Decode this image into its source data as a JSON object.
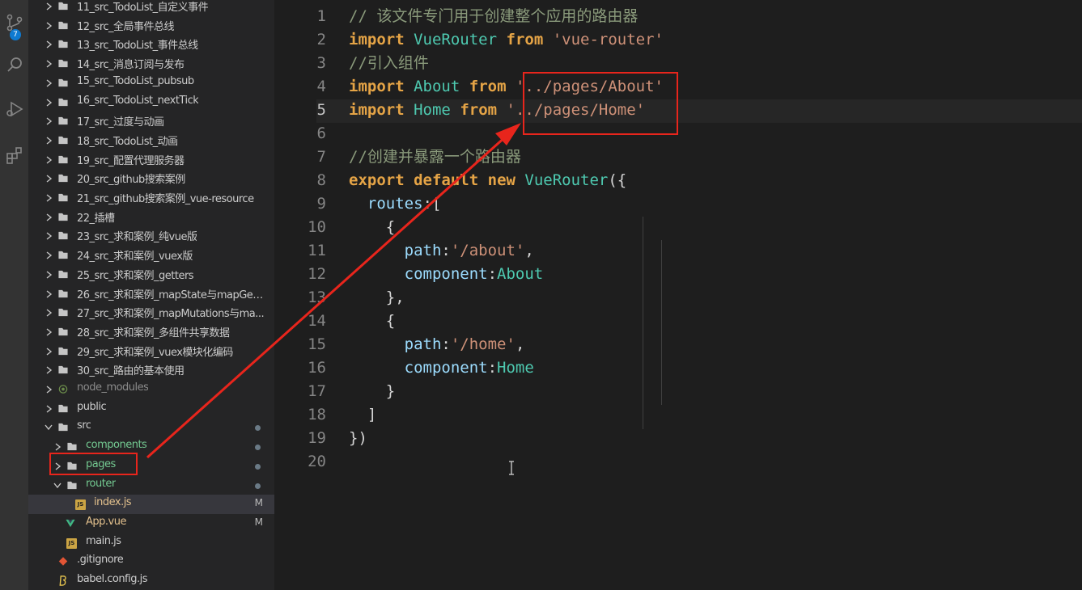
{
  "activity_bar": {
    "items": [
      {
        "icon": "source-control-icon",
        "badge": "7"
      },
      {
        "icon": "search-icon"
      },
      {
        "icon": "run-debug-icon"
      },
      {
        "icon": "extensions-icon"
      }
    ]
  },
  "explorer": {
    "rows": [
      {
        "label": "11_src_TodoList_自定义事件",
        "type": "folder"
      },
      {
        "label": "12_src_全局事件总线",
        "type": "folder"
      },
      {
        "label": "13_src_TodoList_事件总线",
        "type": "folder"
      },
      {
        "label": "14_src_消息订阅与发布",
        "type": "folder"
      },
      {
        "label": "15_src_TodoList_pubsub",
        "type": "folder"
      },
      {
        "label": "16_src_TodoList_nextTick",
        "type": "folder"
      },
      {
        "label": "17_src_过度与动画",
        "type": "folder"
      },
      {
        "label": "18_src_TodoList_动画",
        "type": "folder"
      },
      {
        "label": "19_src_配置代理服务器",
        "type": "folder"
      },
      {
        "label": "20_src_github搜索案例",
        "type": "folder"
      },
      {
        "label": "21_src_github搜索案例_vue-resource",
        "type": "folder"
      },
      {
        "label": "22_插槽",
        "type": "folder"
      },
      {
        "label": "23_src_求和案例_纯vue版",
        "type": "folder"
      },
      {
        "label": "24_src_求和案例_vuex版",
        "type": "folder"
      },
      {
        "label": "25_src_求和案例_getters",
        "type": "folder"
      },
      {
        "label": "26_src_求和案例_mapState与mapGett...",
        "type": "folder"
      },
      {
        "label": "27_src_求和案例_mapMutations与ma...",
        "type": "folder"
      },
      {
        "label": "28_src_求和案例_多组件共享数据",
        "type": "folder"
      },
      {
        "label": "29_src_求和案例_vuex模块化编码",
        "type": "folder"
      },
      {
        "label": "30_src_路由的基本使用",
        "type": "folder"
      },
      {
        "label": "node_modules",
        "type": "folder-dim"
      },
      {
        "label": "public",
        "type": "folder"
      },
      {
        "label": "src",
        "type": "folder-open"
      },
      {
        "label": "components",
        "type": "folder-sub"
      },
      {
        "label": "pages",
        "type": "folder-sub"
      },
      {
        "label": "router",
        "type": "folder-sub-open"
      },
      {
        "label": "index.js",
        "type": "js-file",
        "status": "M"
      },
      {
        "label": "App.vue",
        "type": "vue-file",
        "status": "M"
      },
      {
        "label": "main.js",
        "type": "js-file"
      },
      {
        "label": ".gitignore",
        "type": "git-file"
      },
      {
        "label": "babel.config.js",
        "type": "babel-file"
      }
    ]
  },
  "editor": {
    "lines": [
      {
        "n": "1",
        "tokens": [
          {
            "t": "// 该文件专门用于创建整个应用的路由器",
            "c": "cm"
          }
        ]
      },
      {
        "n": "2",
        "tokens": [
          {
            "t": "import",
            "c": "kw-orange"
          },
          {
            "t": " ",
            "c": "plain"
          },
          {
            "t": "VueRouter",
            "c": "cls"
          },
          {
            "t": " ",
            "c": "plain"
          },
          {
            "t": "from",
            "c": "kw-orange"
          },
          {
            "t": " ",
            "c": "plain"
          },
          {
            "t": "'vue-router'",
            "c": "str"
          }
        ]
      },
      {
        "n": "3",
        "tokens": [
          {
            "t": "//引入组件",
            "c": "cm"
          }
        ]
      },
      {
        "n": "4",
        "tokens": [
          {
            "t": "import",
            "c": "kw-orange"
          },
          {
            "t": " ",
            "c": "plain"
          },
          {
            "t": "About",
            "c": "cls"
          },
          {
            "t": " ",
            "c": "plain"
          },
          {
            "t": "from",
            "c": "kw-orange"
          },
          {
            "t": " ",
            "c": "plain"
          },
          {
            "t": "'../pages/About'",
            "c": "str"
          }
        ]
      },
      {
        "n": "5",
        "tokens": [
          {
            "t": "import",
            "c": "kw-orange"
          },
          {
            "t": " ",
            "c": "plain"
          },
          {
            "t": "Home",
            "c": "cls"
          },
          {
            "t": " ",
            "c": "plain"
          },
          {
            "t": "from",
            "c": "kw-orange"
          },
          {
            "t": " ",
            "c": "plain"
          },
          {
            "t": "'../pages/Home'",
            "c": "str"
          }
        ]
      },
      {
        "n": "6",
        "tokens": []
      },
      {
        "n": "7",
        "tokens": [
          {
            "t": "//创建并暴露一个路由器",
            "c": "cm"
          }
        ]
      },
      {
        "n": "8",
        "tokens": [
          {
            "t": "export",
            "c": "kw-orange"
          },
          {
            "t": " ",
            "c": "plain"
          },
          {
            "t": "default",
            "c": "kw-orange"
          },
          {
            "t": " ",
            "c": "plain"
          },
          {
            "t": "new",
            "c": "kw-orange"
          },
          {
            "t": " ",
            "c": "plain"
          },
          {
            "t": "VueRouter",
            "c": "cls"
          },
          {
            "t": "({",
            "c": "plain"
          }
        ]
      },
      {
        "n": "9",
        "tokens": [
          {
            "t": "  ",
            "c": "plain"
          },
          {
            "t": "routes",
            "c": "prop"
          },
          {
            "t": ":[",
            "c": "plain"
          }
        ]
      },
      {
        "n": "10",
        "tokens": [
          {
            "t": "    {",
            "c": "plain"
          }
        ]
      },
      {
        "n": "11",
        "tokens": [
          {
            "t": "      ",
            "c": "plain"
          },
          {
            "t": "path",
            "c": "prop"
          },
          {
            "t": ":",
            "c": "plain"
          },
          {
            "t": "'/about'",
            "c": "str"
          },
          {
            "t": ",",
            "c": "plain"
          }
        ]
      },
      {
        "n": "12",
        "tokens": [
          {
            "t": "      ",
            "c": "plain"
          },
          {
            "t": "component",
            "c": "prop"
          },
          {
            "t": ":",
            "c": "plain"
          },
          {
            "t": "About",
            "c": "cls"
          }
        ]
      },
      {
        "n": "13",
        "tokens": [
          {
            "t": "    },",
            "c": "plain"
          }
        ]
      },
      {
        "n": "14",
        "tokens": [
          {
            "t": "    {",
            "c": "plain"
          }
        ]
      },
      {
        "n": "15",
        "tokens": [
          {
            "t": "      ",
            "c": "plain"
          },
          {
            "t": "path",
            "c": "prop"
          },
          {
            "t": ":",
            "c": "plain"
          },
          {
            "t": "'/home'",
            "c": "str"
          },
          {
            "t": ",",
            "c": "plain"
          }
        ]
      },
      {
        "n": "16",
        "tokens": [
          {
            "t": "      ",
            "c": "plain"
          },
          {
            "t": "component",
            "c": "prop"
          },
          {
            "t": ":",
            "c": "plain"
          },
          {
            "t": "Home",
            "c": "cls"
          }
        ]
      },
      {
        "n": "17",
        "tokens": [
          {
            "t": "    }",
            "c": "plain"
          }
        ]
      },
      {
        "n": "18",
        "tokens": [
          {
            "t": "  ]",
            "c": "plain"
          }
        ]
      },
      {
        "n": "19",
        "tokens": [
          {
            "t": "})",
            "c": "plain"
          }
        ]
      },
      {
        "n": "20",
        "tokens": []
      }
    ]
  },
  "colors": {
    "annotation_red": "#e8251c",
    "keyword": "#e5a446",
    "class_name": "#4ec9b0",
    "string": "#ce9178"
  }
}
